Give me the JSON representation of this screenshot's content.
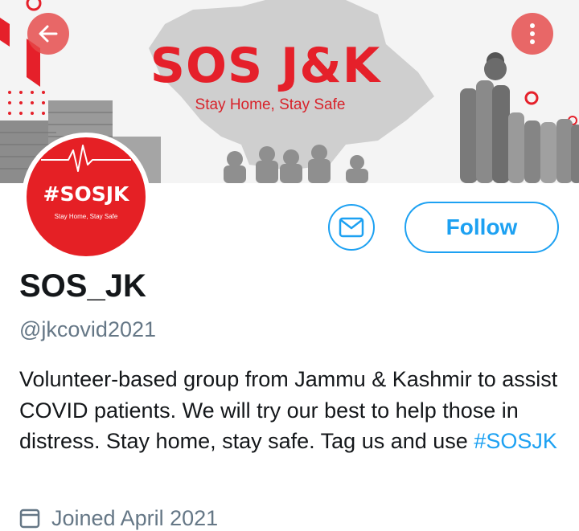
{
  "banner": {
    "title": "SOS J&K",
    "subtitle": "Stay Home, Stay Safe",
    "colors": {
      "accent": "#e5202a",
      "background": "#f4f4f4"
    }
  },
  "navigation": {
    "back_icon": "arrow-left-icon",
    "more_icon": "more-vertical-icon"
  },
  "avatar": {
    "tag": "#SOSJK",
    "subtitle": "Stay Home, Stay Safe",
    "color": "#e52025"
  },
  "actions": {
    "message_icon": "envelope-icon",
    "follow_label": "Follow",
    "accent_color": "#1da1f2"
  },
  "profile": {
    "display_name": "SOS_JK",
    "handle": "@jkcovid2021",
    "bio_text": "Volunteer-based group from Jammu & Kashmir to assist COVID patients. We will try our best to help those in distress. Stay home, stay safe. Tag us and use ",
    "bio_hashtag": "#SOSJK",
    "joined_icon": "calendar-icon",
    "joined": "Joined April 2021"
  }
}
